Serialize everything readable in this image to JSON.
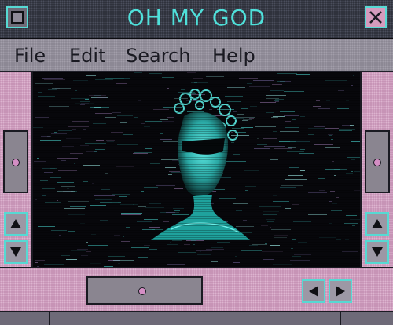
{
  "window": {
    "title": "OH MY GOD",
    "control_box_icon": "window-menu-icon",
    "close_icon": "close-x-icon"
  },
  "menu": {
    "items": [
      {
        "label": "File"
      },
      {
        "label": "Edit"
      },
      {
        "label": "Search"
      },
      {
        "label": "Help"
      }
    ]
  },
  "colors": {
    "accent_cyan": "#4fe0da",
    "title_bg": "#2a2d36",
    "menu_bg": "#8a8692",
    "scroll_pink": "#c48fb3",
    "image_bg": "#07070b"
  },
  "scrollbars": {
    "vertical": {
      "up_icon": "arrow-up-icon",
      "down_icon": "arrow-down-icon"
    },
    "horizontal": {
      "left_icon": "arrow-left-icon",
      "right_icon": "arrow-right-icon"
    }
  },
  "viewport": {
    "content_icon": "glitched-portrait-image"
  }
}
